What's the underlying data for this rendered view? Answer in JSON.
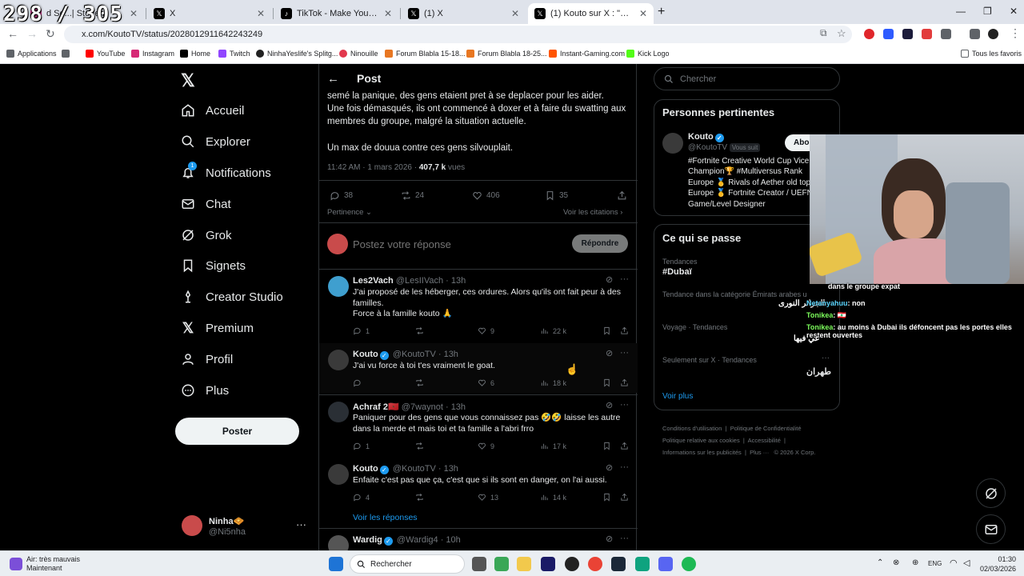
{
  "overlay": {
    "counter": "298 / 305"
  },
  "browser": {
    "tabs": [
      {
        "title": "d Se...| Storie..."
      },
      {
        "title": "X"
      },
      {
        "title": "TikTok - Make Your Day"
      },
      {
        "title": "(1) X"
      },
      {
        "title": "(1) Kouto sur X : \"Update de la..."
      }
    ],
    "url": "x.com/KoutoTV/status/2028012911642243249",
    "bookmarks": [
      "Applications",
      "YouTube",
      "Instagram",
      "Home",
      "Twitch",
      "NinhaYeslife's Splitg...",
      "Ninouille",
      "Forum Blabla 15-18...",
      "Forum Blabla 18-25...",
      "Instant-Gaming.com",
      "Kick Logo"
    ],
    "all_favorites": "Tous les favoris"
  },
  "nav": {
    "items": [
      "Accueil",
      "Explorer",
      "Notifications",
      "Chat",
      "Grok",
      "Signets",
      "Creator Studio",
      "Premium",
      "Profil",
      "Plus"
    ],
    "notif_badge": "1",
    "post_button": "Poster",
    "user_name": "Ninha🧇",
    "user_handle": "@Ni5nha"
  },
  "post": {
    "header": "Post",
    "text1": "semé la panique, des gens etaient pret à se deplacer pour les aider.",
    "text2": "Une fois démasqués, ils ont commencé à doxer et à faire du swatting aux membres du groupe, malgré la situation actuelle.",
    "text3": "Un max de douua contre ces gens silvouplait.",
    "time": "11:42 AM · 1 mars 2026 · ",
    "views_num": "407,7 k",
    "views_label": " vues",
    "replies": "38",
    "reposts": "24",
    "likes": "406",
    "bookmarks": "35",
    "pertinence": "Pertinence",
    "citations": "Voir les citations",
    "reply_placeholder": "Postez votre réponse",
    "reply_button": "Répondre"
  },
  "replies": [
    {
      "name": "Les2Vach",
      "handle": "@LesIIVach · 13h",
      "text": "J'ai proposé de les héberger, ces ordures. Alors qu'ils ont fait peur à des familles.",
      "text2": "Force à la famille kouto 🙏",
      "replies": "1",
      "reposts": "",
      "likes": "9",
      "views": "22 k"
    },
    {
      "name": "Kouto",
      "handle": "@KoutoTV · 13h",
      "text": "J'ai vu force à toi t'es vraiment le goat.",
      "replies": "",
      "reposts": "",
      "likes": "6",
      "views": "18 k"
    },
    {
      "name": "Achraf 2🇲🇦",
      "handle": "@7waynot · 13h",
      "text": "Paniquer pour des gens que vous connaissez pas 🤣🤣 laisse les autre dans la merde et mais toi et ta famille a l'abri frro",
      "replies": "1",
      "reposts": "",
      "likes": "9",
      "views": "17 k"
    },
    {
      "name": "Kouto",
      "handle": "@KoutoTV · 13h",
      "text": "Enfaite c'est pas que ça, c'est que si ils sont en danger, on l'ai aussi.",
      "replies": "4",
      "reposts": "",
      "likes": "13",
      "views": "14 k"
    },
    {
      "name": "Wardig",
      "handle": "@Wardig4 · 10h",
      "text": "",
      "replies": "",
      "reposts": "",
      "likes": "",
      "views": ""
    }
  ],
  "see_replies": "Voir les réponses",
  "right": {
    "search_placeholder": "Chercher",
    "relevant_title": "Personnes pertinentes",
    "kouto_name": "Kouto",
    "kouto_handle": "@KoutoTV",
    "follows_you": "Vous suit",
    "subscribe": "Abon",
    "bio1": "#Fortnite Creative World Cup Vice",
    "bio2": "Champion🏆 #Multiversus Rank",
    "bio3": "Europe 🥇 Rivals of Aether old top",
    "bio4": "Europe 🥇 Fortnite Creator / UEFN",
    "bio5": "Game/Level Designer",
    "happening_title": "Ce qui se passe",
    "trends": [
      {
        "category": "Tendances",
        "name": "#Dubaï"
      },
      {
        "category": "Tendance dans la catégorie Émirats arabes u",
        "name": ""
      },
      {
        "category": "Voyage · Tendances",
        "name": ""
      },
      {
        "category": "Seulement sur X · Tendances",
        "name": "طهران"
      }
    ],
    "see_more": "Voir plus",
    "footer1": "Conditions d'utilisation",
    "footer2": "Politique de Confidentialité",
    "footer3": "Politique relative aux cookies",
    "footer4": "Accessibilité",
    "footer5": "Informations sur les publicités",
    "footer6": "Plus ···",
    "footer7": "© 2026 X Corp."
  },
  "stream_chat": [
    {
      "user": "",
      "msg": "dans le groupe expat"
    },
    {
      "user": "Netanyahuu",
      "msg": ": non"
    },
    {
      "user": "Tonikea",
      "msg": ": 🇱🇧"
    },
    {
      "user": "Tonikea",
      "msg": ": au moins à Dubai ils défoncent pas les portes elles restent ouvertes"
    }
  ],
  "arabic1": "الجزائر النورى",
  "arabic2": "عي فيها",
  "taskbar": {
    "weather": "Air: très mauvais",
    "weather2": "Maintenant",
    "search": "Rechercher",
    "lang": "ENG",
    "time": "01:30",
    "date": "02/03/2026"
  }
}
